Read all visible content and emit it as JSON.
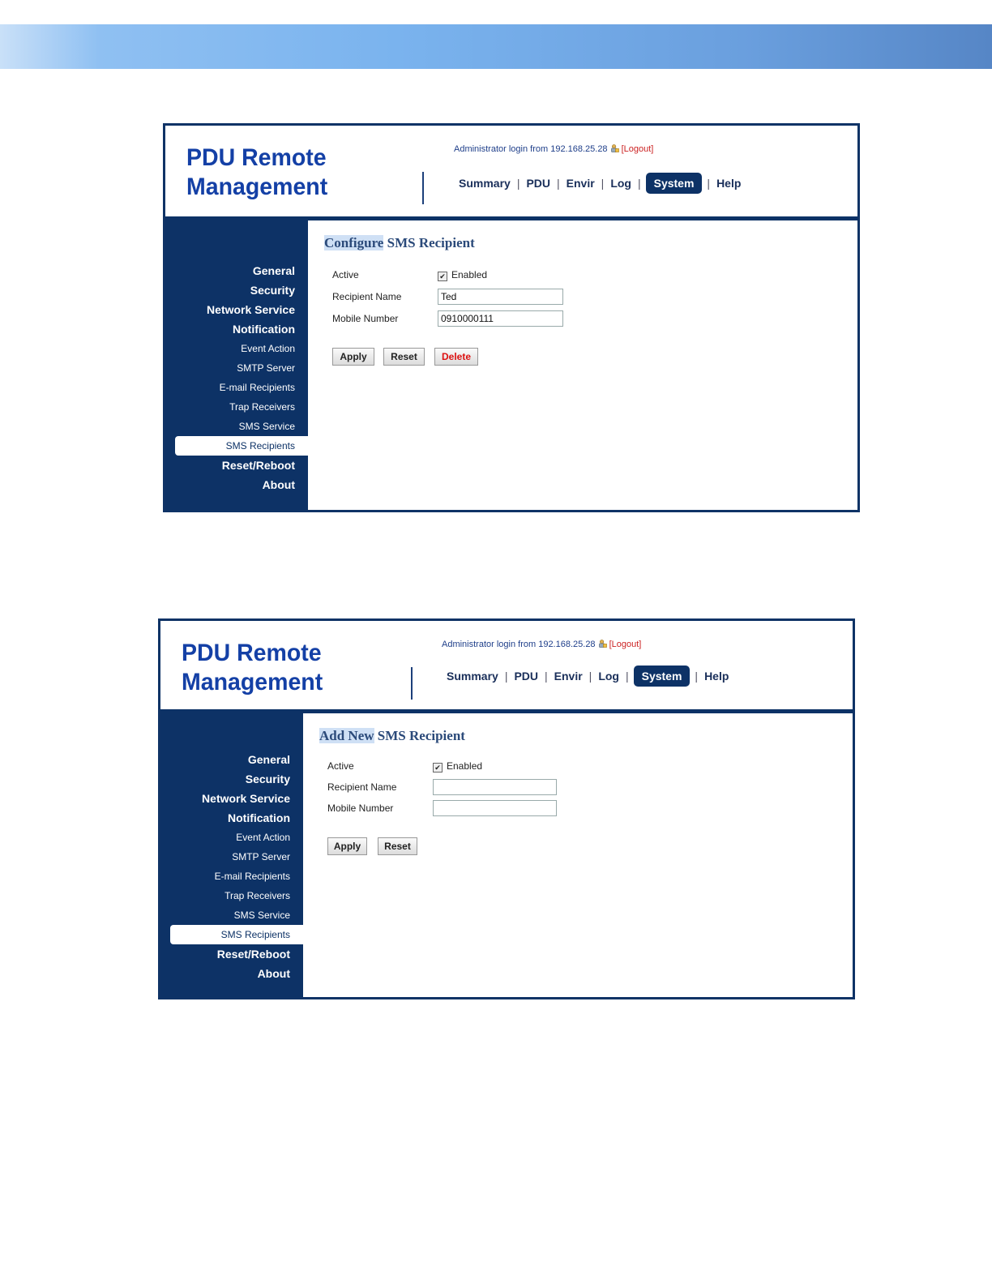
{
  "logo": {
    "line1": "PDU Remote",
    "line2": "Management"
  },
  "login": {
    "text": "Administrator login from 192.168.25.28",
    "logout": "[Logout]"
  },
  "nav": [
    "Summary",
    "PDU",
    "Envir",
    "Log",
    "System",
    "Help"
  ],
  "nav_active": "System",
  "sidebar": [
    {
      "label": "General",
      "kind": "major"
    },
    {
      "label": "Security",
      "kind": "major"
    },
    {
      "label": "Network Service",
      "kind": "major"
    },
    {
      "label": "Notification",
      "kind": "major"
    },
    {
      "label": "Event Action",
      "kind": "minor"
    },
    {
      "label": "SMTP Server",
      "kind": "minor"
    },
    {
      "label": "E-mail Recipients",
      "kind": "minor"
    },
    {
      "label": "Trap Receivers",
      "kind": "minor"
    },
    {
      "label": "SMS Service",
      "kind": "minor"
    },
    {
      "label": "SMS Recipients",
      "kind": "minor",
      "selected": true
    },
    {
      "label": "Reset/Reboot",
      "kind": "major"
    },
    {
      "label": "About",
      "kind": "major"
    }
  ],
  "panel1": {
    "title_hl": "Configure",
    "title_rest": " SMS Recipient",
    "active_label": "Active",
    "enabled_label": "Enabled",
    "name_label": "Recipient Name",
    "name_value": "Ted",
    "mobile_label": "Mobile Number",
    "mobile_value": "0910000111",
    "apply": "Apply",
    "reset": "Reset",
    "delete": "Delete"
  },
  "panel2": {
    "title_hl": "Add New",
    "title_rest": " SMS Recipient",
    "active_label": "Active",
    "enabled_label": "Enabled",
    "name_label": "Recipient Name",
    "name_value": "",
    "mobile_label": "Mobile Number",
    "mobile_value": "",
    "apply": "Apply",
    "reset": "Reset"
  },
  "colors": {
    "navy": "#0d3266",
    "logo_blue": "#1440a6",
    "logout_red": "#cc2222",
    "delete_red": "#dd1111"
  }
}
